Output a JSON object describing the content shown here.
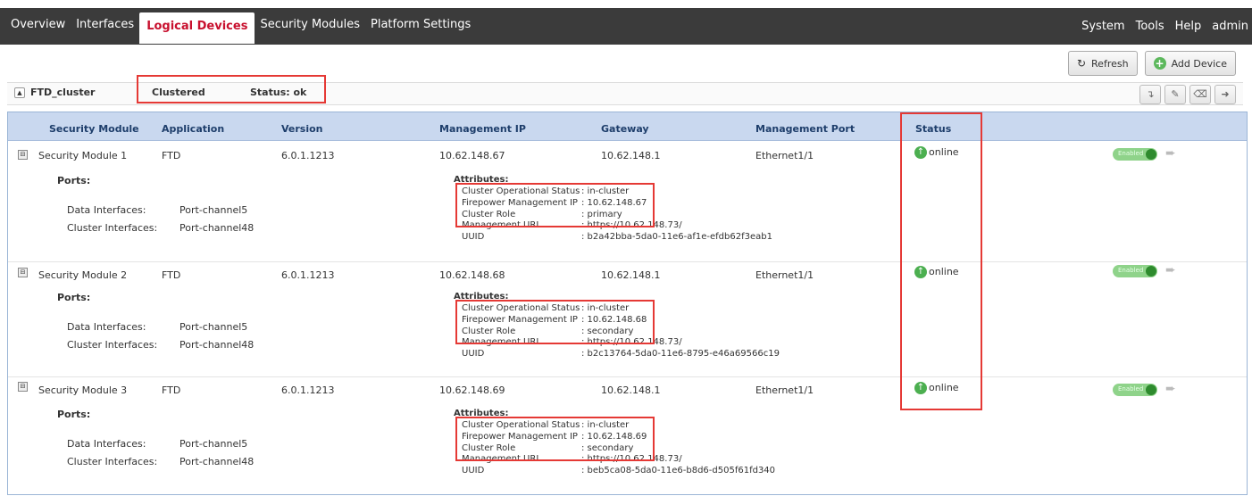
{
  "nav": {
    "tabs": [
      "Overview",
      "Interfaces",
      "Logical Devices",
      "Security Modules",
      "Platform Settings"
    ],
    "active": "Logical Devices",
    "right": [
      "System",
      "Tools",
      "Help",
      "admin"
    ]
  },
  "toolbar": {
    "refresh": "Refresh",
    "add_device": "Add Device"
  },
  "device": {
    "name": "FTD_cluster",
    "mode": "Clustered",
    "status": "Status: ok"
  },
  "table": {
    "headers": [
      "Security Module",
      "Application",
      "Version",
      "Management IP",
      "Gateway",
      "Management Port",
      "Status"
    ],
    "ports_label": "Ports:",
    "attributes_label": "Attributes:",
    "data_if_label": "Data Interfaces:",
    "cluster_if_label": "Cluster Interfaces:",
    "attr_keys": [
      "Cluster Operational Status",
      "Firepower Management IP",
      "Cluster Role",
      "Management URL",
      "UUID"
    ],
    "toggle_label": "Enabled",
    "rows": [
      {
        "module": "Security Module 1",
        "app": "FTD",
        "version": "6.0.1.1213",
        "mgmt_ip": "10.62.148.67",
        "gateway": "10.62.148.1",
        "port": "Ethernet1/1",
        "status": "online",
        "data_if": "Port-channel5",
        "cluster_if": "Port-channel48",
        "attrs": {
          "op_status": ": in-cluster",
          "fmc_ip": ": 10.62.148.67",
          "role": ": primary",
          "url": ": https://10.62.148.73/",
          "uuid": ": b2a42bba-5da0-11e6-af1e-efdb62f3eab1"
        }
      },
      {
        "module": "Security Module 2",
        "app": "FTD",
        "version": "6.0.1.1213",
        "mgmt_ip": "10.62.148.68",
        "gateway": "10.62.148.1",
        "port": "Ethernet1/1",
        "status": "online",
        "data_if": "Port-channel5",
        "cluster_if": "Port-channel48",
        "attrs": {
          "op_status": ": in-cluster",
          "fmc_ip": ": 10.62.148.68",
          "role": ": secondary",
          "url": ": https://10.62.148.73/",
          "uuid": ": b2c13764-5da0-11e6-8795-e46a69566c19"
        }
      },
      {
        "module": "Security Module 3",
        "app": "FTD",
        "version": "6.0.1.1213",
        "mgmt_ip": "10.62.148.69",
        "gateway": "10.62.148.1",
        "port": "Ethernet1/1",
        "status": "online",
        "data_if": "Port-channel5",
        "cluster_if": "Port-channel48",
        "attrs": {
          "op_status": ": in-cluster",
          "fmc_ip": ": 10.62.148.69",
          "role": ": secondary",
          "url": ": https://10.62.148.73/",
          "uuid": ": beb5ca08-5da0-11e6-b8d6-d505f61fd340"
        }
      }
    ]
  },
  "colors": {
    "accent": "#c8102e",
    "highlight": "#e53935",
    "online": "#4caf50",
    "header": "#c9d8ef"
  }
}
